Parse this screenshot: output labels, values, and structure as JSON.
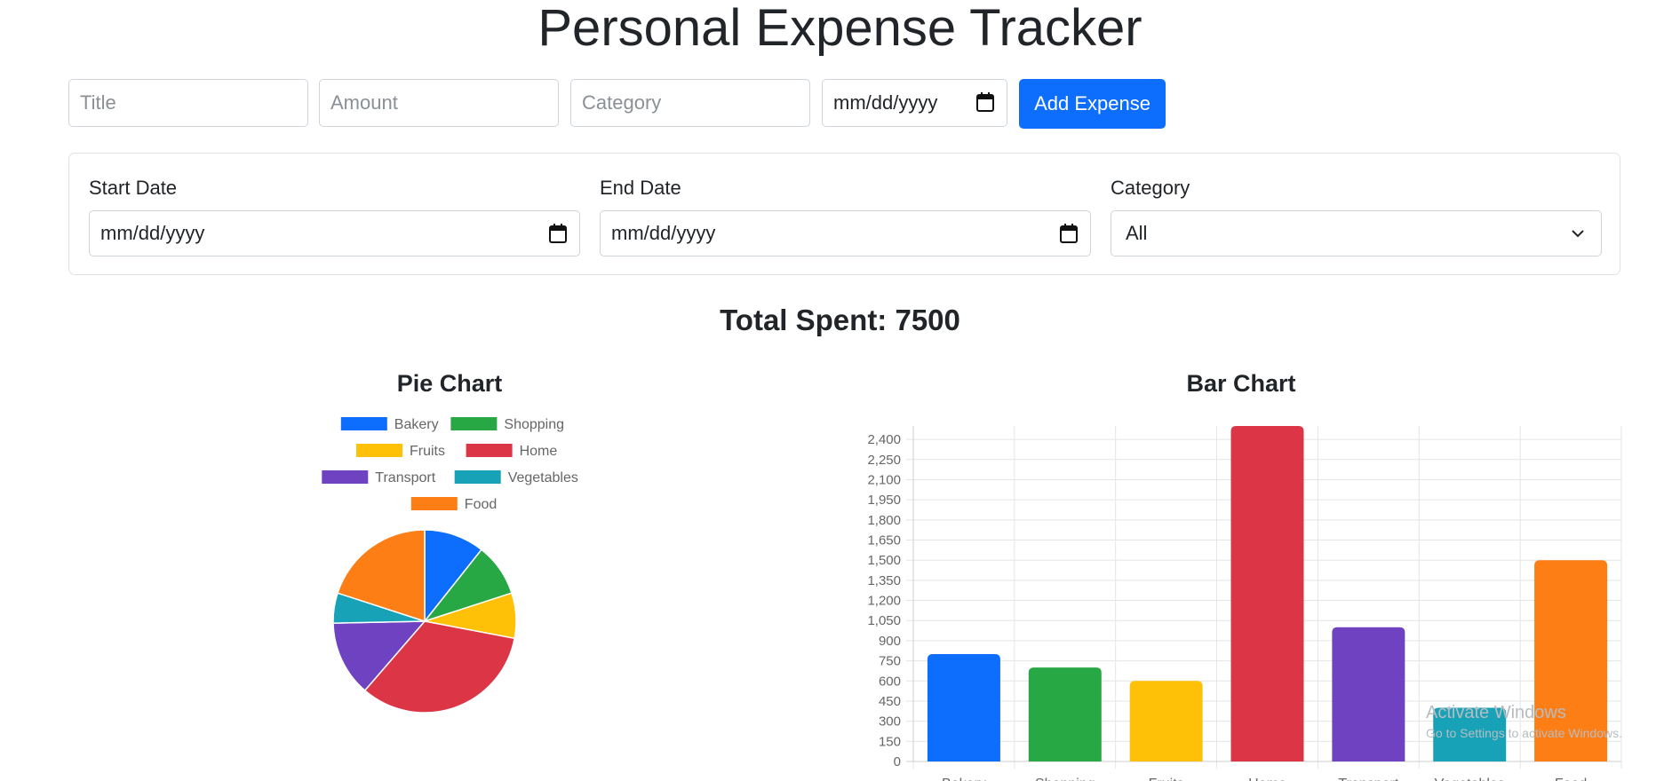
{
  "page": {
    "title": "Personal Expense Tracker"
  },
  "form": {
    "title_placeholder": "Title",
    "amount_placeholder": "Amount",
    "category_placeholder": "Category",
    "date_value": "mm/dd/yyyy",
    "add_button": "Add Expense"
  },
  "filters": {
    "start_label": "Start Date",
    "start_value": "mm/dd/yyyy",
    "end_label": "End Date",
    "end_value": "mm/dd/yyyy",
    "category_label": "Category",
    "category_value": "All"
  },
  "summary": {
    "total_text": "Total Spent: 7500"
  },
  "pie": {
    "heading": "Pie Chart"
  },
  "bar": {
    "heading": "Bar Chart"
  },
  "chart_data": [
    {
      "type": "pie",
      "categories": [
        "Bakery",
        "Shopping",
        "Fruits",
        "Home",
        "Transport",
        "Vegetables",
        "Food"
      ],
      "values": [
        800,
        700,
        600,
        2500,
        1000,
        400,
        1500
      ],
      "colors": [
        "#0d6efd",
        "#28a745",
        "#ffc107",
        "#dc3545",
        "#6f42c1",
        "#17a2b8",
        "#fd7e14"
      ],
      "legend_position": "top"
    },
    {
      "type": "bar",
      "categories": [
        "Bakery",
        "Shopping",
        "Fruits",
        "Home",
        "Transport",
        "Vegetables",
        "Food"
      ],
      "values": [
        800,
        700,
        600,
        2500,
        1000,
        400,
        1500
      ],
      "colors": [
        "#0d6efd",
        "#28a745",
        "#ffc107",
        "#dc3545",
        "#6f42c1",
        "#17a2b8",
        "#fd7e14"
      ],
      "ylim": [
        0,
        2500
      ],
      "yticks": [
        "0",
        "150",
        "300",
        "450",
        "600",
        "750",
        "900",
        "1,050",
        "1,200",
        "1,350",
        "1,500",
        "1,650",
        "1,800",
        "1,950",
        "2,100",
        "2,250",
        "2,400"
      ],
      "grid": true
    }
  ],
  "watermark": {
    "line1": "Activate Windows",
    "line2": "Go to Settings to activate Windows."
  }
}
